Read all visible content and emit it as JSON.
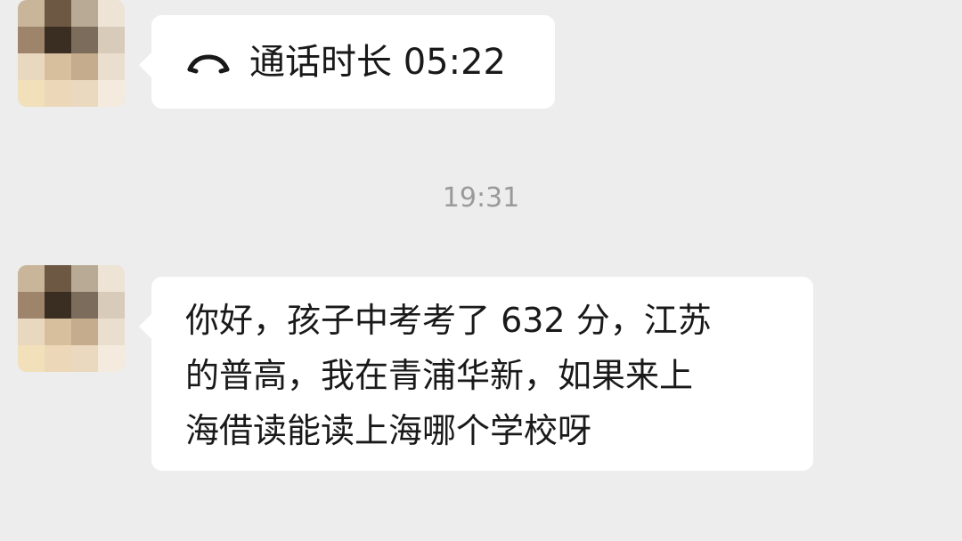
{
  "conversation": {
    "call_message": {
      "icon": "phone-hangup-icon",
      "text": "通话时长 05:22"
    },
    "timestamp": "19:31",
    "text_message": {
      "text": "你好，孩子中考考了 632 分，江苏\n的普高，我在青浦华新，如果来上\n海借读能读上海哪个学校呀"
    }
  },
  "colors": {
    "background": "#ededed",
    "bubble": "#ffffff",
    "text": "#191919",
    "timestamp": "#9a9a9a"
  }
}
